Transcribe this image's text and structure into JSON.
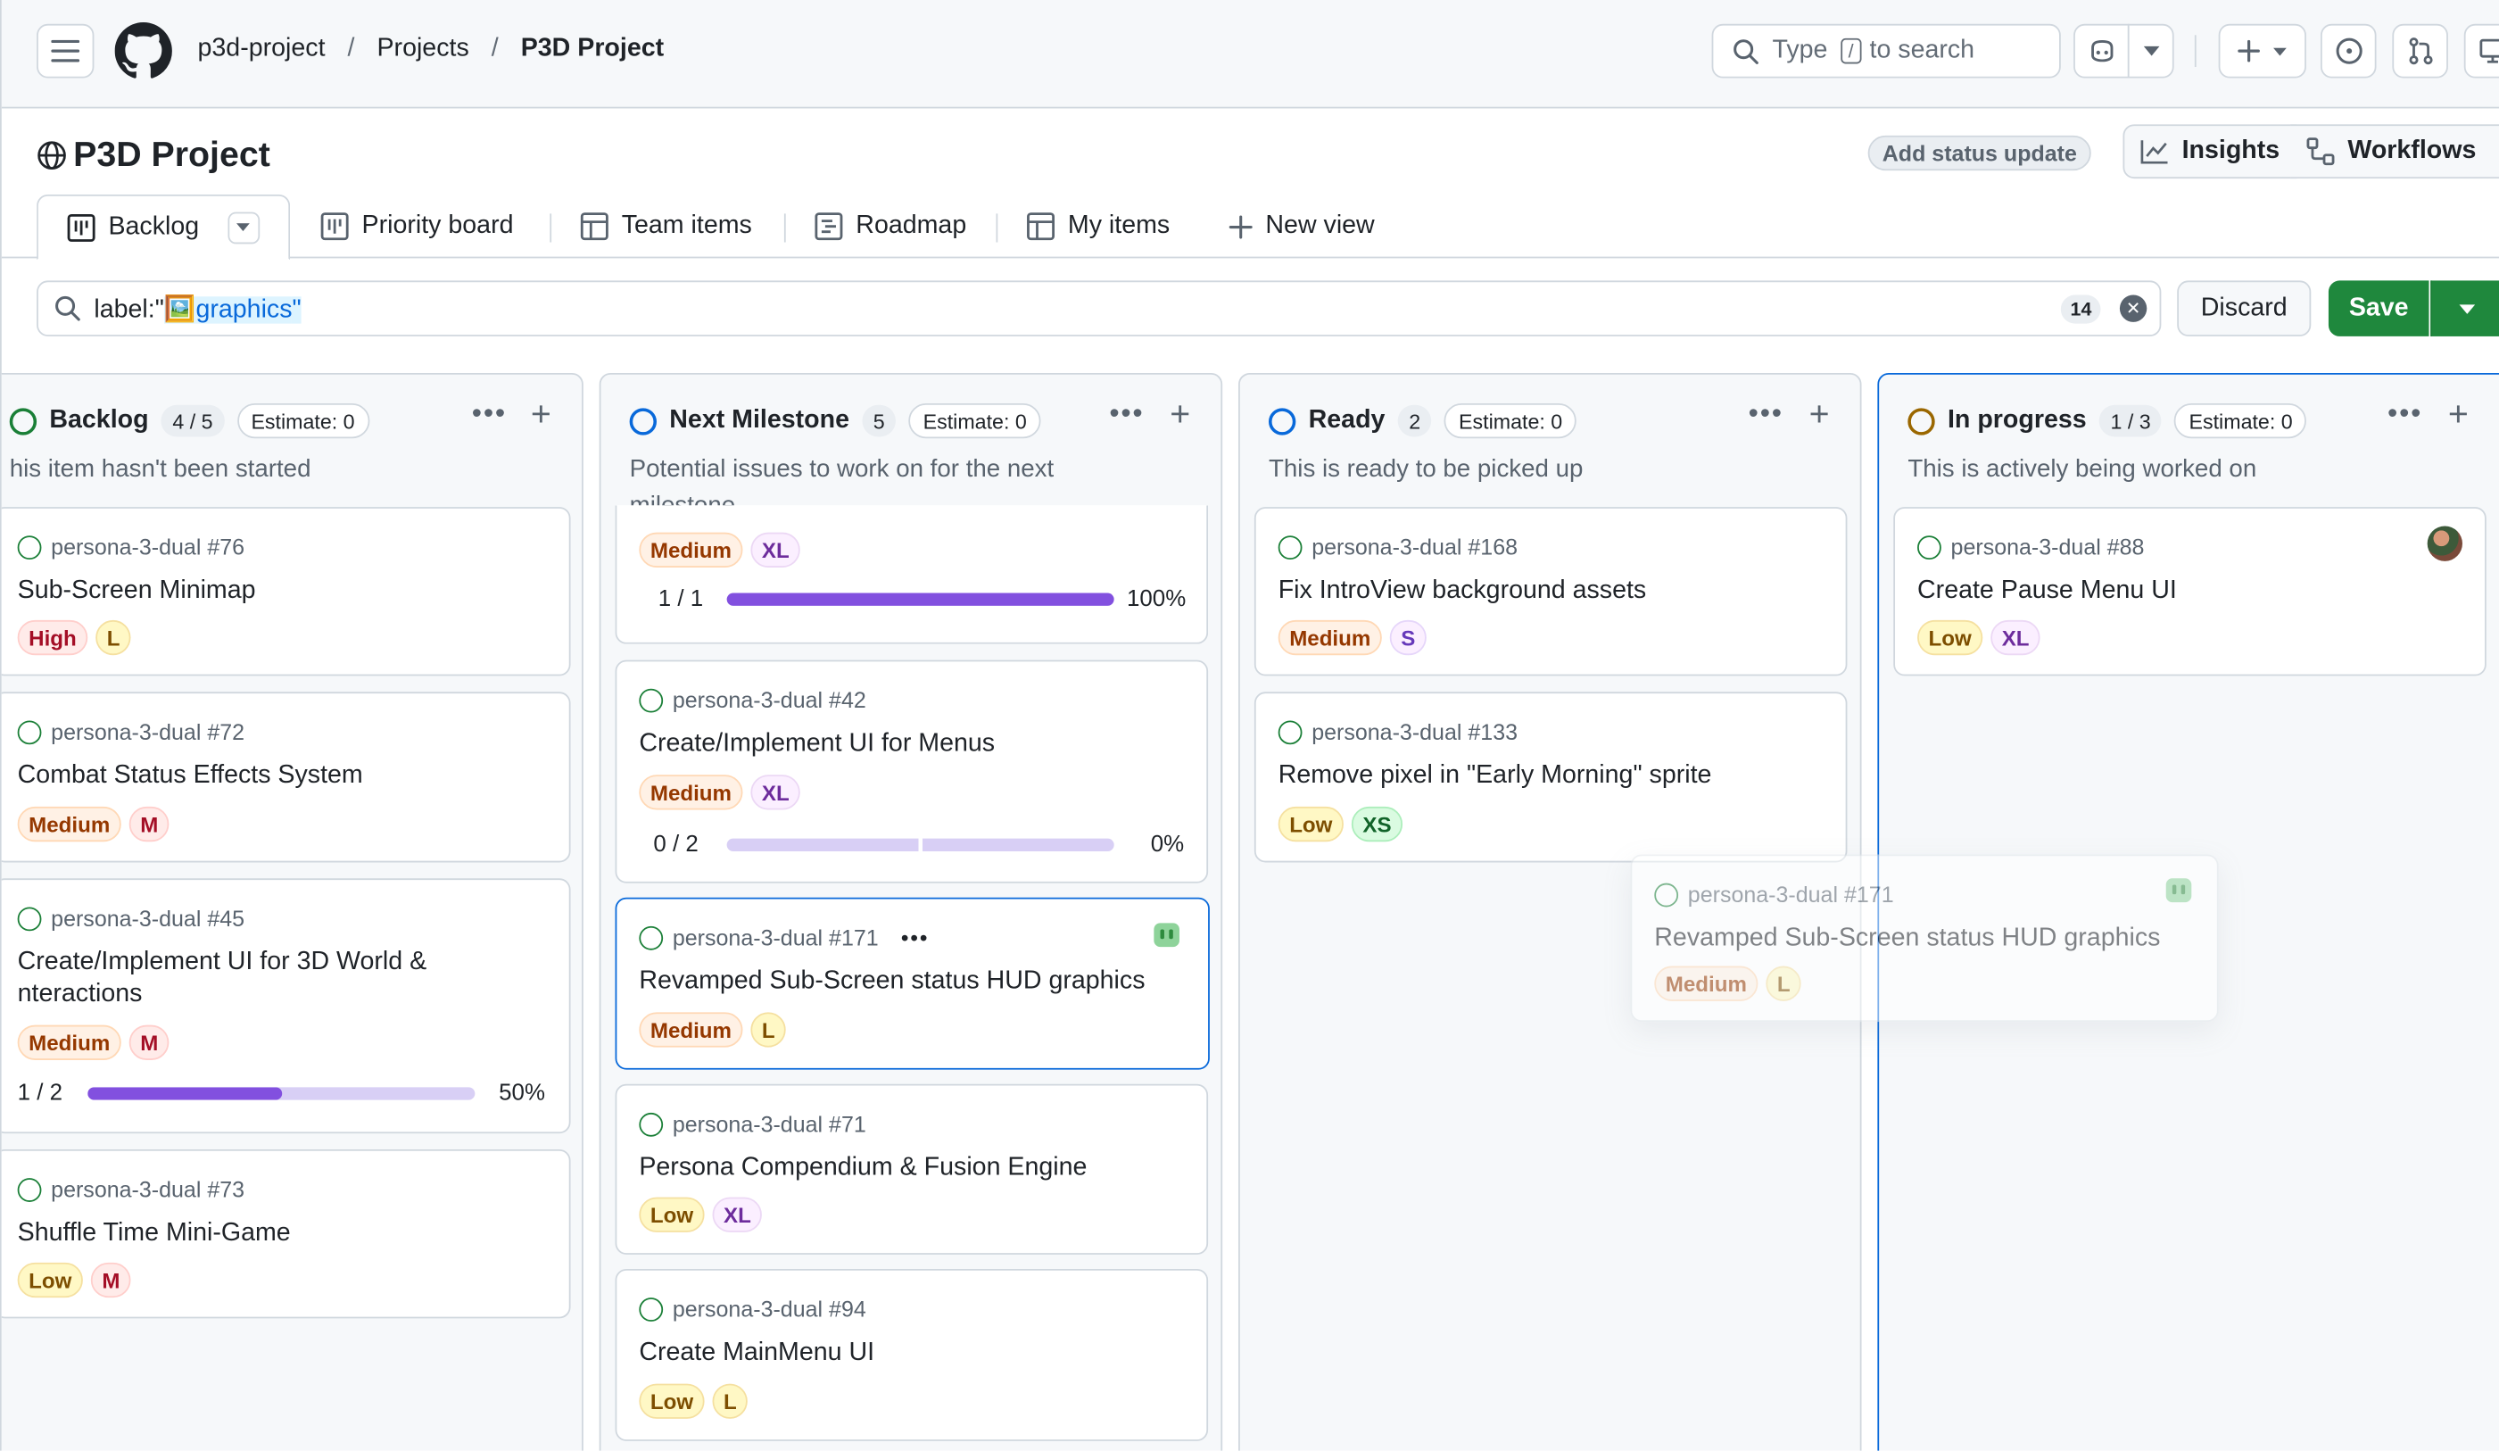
{
  "header": {
    "breadcrumbs": [
      "p3d-project",
      "Projects",
      "P3D Project"
    ],
    "search_type": "Type",
    "search_key": "/",
    "search_rest": "to search"
  },
  "project": {
    "title": "P3D Project",
    "add_status": "Add status update",
    "insights": "Insights",
    "workflows": "Workflows"
  },
  "tabs": [
    {
      "label": "Backlog"
    },
    {
      "label": "Priority board"
    },
    {
      "label": "Team items"
    },
    {
      "label": "Roadmap"
    },
    {
      "label": "My items"
    },
    {
      "label": "New view"
    }
  ],
  "filter": {
    "prefix": "label:\"",
    "emoji": "🖼️",
    "value": "graphics",
    "suffix": "\"",
    "count": "14",
    "discard": "Discard",
    "save": "Save"
  },
  "columns": [
    {
      "name": "Backlog",
      "count": "4 / 5",
      "estimate": "Estimate: 0",
      "description": "his item hasn't been started",
      "cards": [
        {
          "ref": "persona-3-dual #76",
          "title": "Sub-Screen Minimap",
          "labels": [
            "High",
            "L"
          ]
        },
        {
          "ref": "persona-3-dual #72",
          "title": "Combat Status Effects System",
          "labels": [
            "Medium",
            "M"
          ]
        },
        {
          "ref": "persona-3-dual #45",
          "title": "Create/Implement UI for 3D World &",
          "title2": "nteractions",
          "labels": [
            "Medium",
            "M"
          ],
          "progress": "1 / 2",
          "percent": "50%"
        },
        {
          "ref": "persona-3-dual #73",
          "title": "Shuffle Time Mini-Game",
          "labels": [
            "Low",
            "M"
          ]
        }
      ]
    },
    {
      "name": "Next Milestone",
      "count": "5",
      "estimate": "Estimate: 0",
      "description": "Potential issues to work on for the next",
      "description2": "milestone",
      "cards": [
        {
          "labels": [
            "Medium",
            "XL"
          ],
          "progress": "1 / 1",
          "percent": "100%"
        },
        {
          "ref": "persona-3-dual #42",
          "title": "Create/Implement UI for Menus",
          "labels": [
            "Medium",
            "XL"
          ],
          "progress": "0 / 2",
          "percent": "0%"
        },
        {
          "ref": "persona-3-dual #171",
          "title": "Revamped Sub-Screen status HUD graphics",
          "labels": [
            "Medium",
            "L"
          ]
        },
        {
          "ref": "persona-3-dual #71",
          "title": "Persona Compendium & Fusion Engine",
          "labels": [
            "Low",
            "XL"
          ]
        },
        {
          "ref": "persona-3-dual #94",
          "title": "Create MainMenu UI",
          "labels": [
            "Low",
            "L"
          ]
        }
      ]
    },
    {
      "name": "Ready",
      "count": "2",
      "estimate": "Estimate: 0",
      "description": "This is ready to be picked up",
      "cards": [
        {
          "ref": "persona-3-dual #168",
          "title": "Fix IntroView background assets",
          "labels": [
            "Medium",
            "S"
          ]
        },
        {
          "ref": "persona-3-dual #133",
          "title": "Remove pixel in \"Early Morning\" sprite",
          "labels": [
            "Low",
            "XS"
          ]
        }
      ]
    },
    {
      "name": "In progress",
      "count": "1 / 3",
      "estimate": "Estimate: 0",
      "description": "This is actively being worked on",
      "cards": [
        {
          "ref": "persona-3-dual #88",
          "title": "Create Pause Menu UI",
          "labels": [
            "Low",
            "XL"
          ]
        }
      ]
    }
  ],
  "drag_ghost": {
    "ref": "persona-3-dual #171",
    "title": "Revamped Sub-Screen status HUD graphics",
    "labels": [
      "Medium",
      "L"
    ]
  },
  "progress_values": {
    "backlog_45": 0.5,
    "next_top": 1.0,
    "next_42": 0.0
  },
  "colors": {
    "accent": "#0969da",
    "save_green": "#1f883d",
    "progress_purple": "#8250df",
    "open_issue": "#1a7f37",
    "ready_ring": "#0969da",
    "inprogress_ring": "#9a6700"
  }
}
